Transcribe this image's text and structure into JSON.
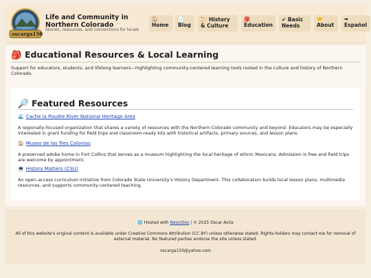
{
  "header": {
    "title": "Life and Community in Northern Colorado",
    "subtitle": "Stories, resources, and connections for locals",
    "logo_text": "oscarga150"
  },
  "nav": [
    {
      "label": "Home",
      "icon": "house-icon",
      "glyph": "🏠"
    },
    {
      "label": "Blog",
      "icon": "blog-icon",
      "glyph": "📄"
    },
    {
      "label": "History & Culture",
      "icon": "scroll-icon",
      "glyph": "📜"
    },
    {
      "label": "Education",
      "icon": "backpack-icon",
      "glyph": "🎒"
    },
    {
      "label": "Basic Needs",
      "icon": "needs-icon",
      "glyph": "✔"
    },
    {
      "label": "About",
      "icon": "heart-hands-icon",
      "glyph": "🤝"
    },
    {
      "label": "Español",
      "icon": "language-icon",
      "glyph": "➡"
    }
  ],
  "page": {
    "title": "Educational Resources & Local Learning",
    "title_icon": "🎒",
    "intro": "Support for educators, students, and lifelong learners—highlighting community-centered learning tools rooted in the culture and history of Northern Colorado."
  },
  "featured": {
    "title": "Featured Resources",
    "title_icon": "🔎",
    "resources": [
      {
        "name": "Cache la Poudre River National Heritage Area",
        "icon": "river-icon",
        "glyph": "🌊",
        "desc": "A regionally-focused organization that shares a variety of resources with the Northern Colorado community and beyond. Educators may be especially interested in grant funding for field trips and classroom-ready kits with historical artifacts, primary sources, and lesson plans."
      },
      {
        "name": "Museo de las Tres Colonias",
        "icon": "museum-icon",
        "glyph": "🏠",
        "desc": "A preserved adobe home in Fort Collins that serves as a museum highlighting the local heritage of ethnic Mexicans. Admission is free and field trips are welcome by appointment."
      },
      {
        "name": "History Matters (CSU)",
        "icon": "computer-icon",
        "glyph": "💻",
        "desc": "An open-access curriculum initiative from Colorado State University's History Department. This collaboration builds local lesson plans, multimedia resources, and supports community-centered teaching."
      }
    ]
  },
  "footer": {
    "hosted_prefix": "Hosted with",
    "hosted_link": "Neocities",
    "hosted_suffix": "| © 2025 Oscar Avila",
    "license": "All of this website's original content is available under Creative Commons Attribution (CC BY) unless otherwise stated. Rights-holders may contact me for removal of external material. No featured parties endorse the site unless stated.",
    "email": "oscarga150@yahoo.com"
  },
  "colors": {
    "background": "#f5ede0",
    "header": "#f7e9d3",
    "nav_button": "#eedcbf",
    "link": "#1a3fb0"
  }
}
